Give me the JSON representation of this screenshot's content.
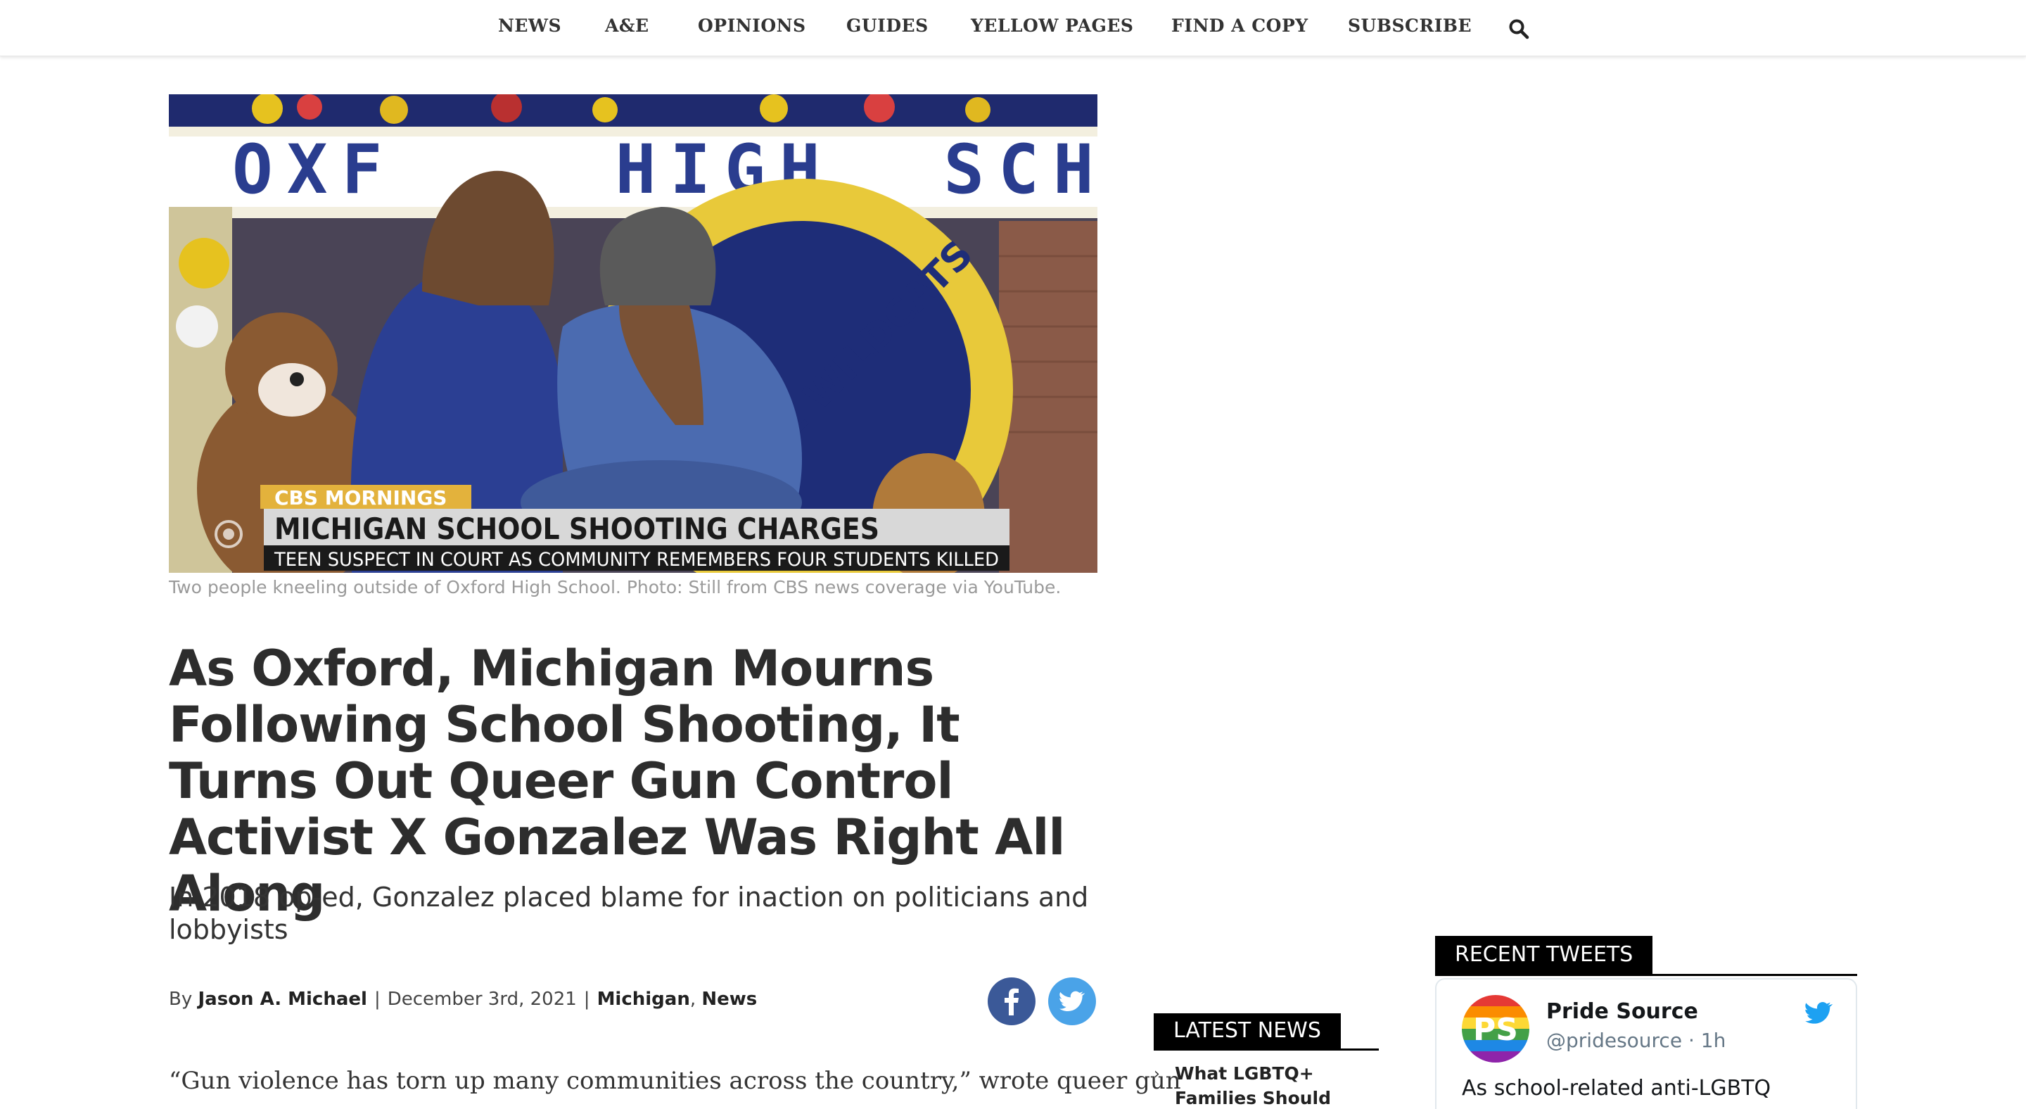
{
  "nav": {
    "items": [
      "NEWS",
      "A&E",
      "OPINIONS",
      "GUIDES",
      "YELLOW PAGES",
      "FIND A COPY",
      "SUBSCRIBE"
    ],
    "search_icon": "search-icon"
  },
  "hero": {
    "sign_text": "OXF    HIGH  SCH",
    "seal_text": "E WILDCATS",
    "broadcast_brand": "CBS MORNINGS",
    "banner_title": "MICHIGAN SCHOOL SHOOTING CHARGES",
    "banner_subtitle": "TEEN SUSPECT IN COURT AS COMMUNITY REMEMBERS FOUR STUDENTS KILLED",
    "caption": "Two people kneeling outside of Oxford High School. Photo: Still from CBS news coverage via YouTube."
  },
  "article": {
    "headline": "As Oxford, Michigan Mourns Following School Shooting, It Turns Out Queer Gun Control Activist X Gonzalez Was Right All Along",
    "subhead": "In 2018 op-ed, Gonzalez placed blame for inaction on politicians and lobbyists",
    "byline_prefix": "By",
    "author": "Jason A. Michael",
    "date": "December 3rd, 2021",
    "category_1": "Michigan",
    "category_2": "News",
    "body_first_line": "“Gun violence has torn up many communities across the country,” wrote queer gun"
  },
  "share": {
    "facebook_icon": "facebook-icon",
    "twitter_icon": "twitter-icon",
    "facebook_color": "#3b5998",
    "twitter_color": "#4aa3e8"
  },
  "latest_news": {
    "title": "LATEST NEWS",
    "items": [
      "What LGBTQ+ Families Should Know For Back-"
    ]
  },
  "recent_tweets": {
    "title": "RECENT TWEETS",
    "tweet": {
      "name": "Pride Source",
      "handle": "@pridesource · 1h",
      "avatar_text": "PS",
      "text": "As school-related anti-LGBTQ"
    }
  }
}
